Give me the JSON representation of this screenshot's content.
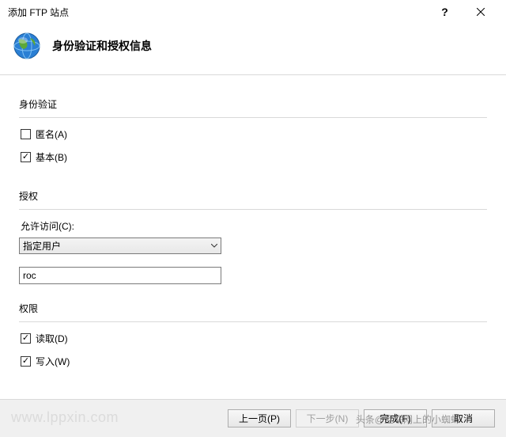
{
  "window": {
    "title": "添加 FTP 站点"
  },
  "header": {
    "title": "身份验证和授权信息"
  },
  "auth": {
    "section_title": "身份验证",
    "anonymous": {
      "label": "匿名(A)",
      "checked": false
    },
    "basic": {
      "label": "基本(B)",
      "checked": true
    }
  },
  "authz": {
    "section_title": "授权",
    "allow_access_label": "允许访问(C):",
    "selected_option": "指定用户",
    "user_value": "roc",
    "perm_title": "权限",
    "read": {
      "label": "读取(D)",
      "checked": true
    },
    "write": {
      "label": "写入(W)",
      "checked": true
    }
  },
  "buttons": {
    "prev": "上一页(P)",
    "next": "下一步(N)",
    "finish": "完成(F)",
    "cancel": "取消"
  },
  "watermark": "www.lppxin.com",
  "watermark2": "头条@互联网上的小蜘蛛"
}
